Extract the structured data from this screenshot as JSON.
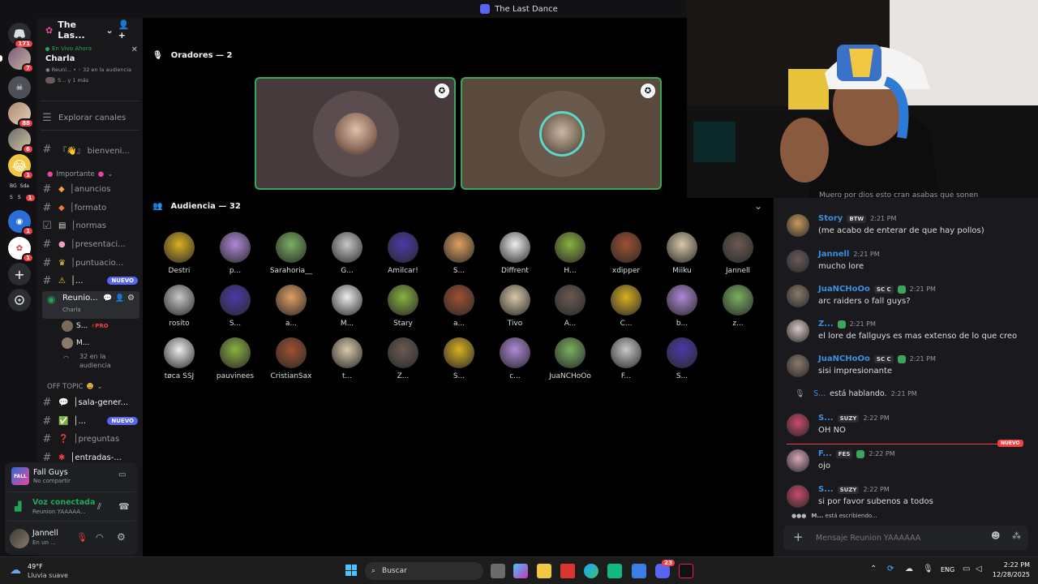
{
  "window": {
    "title": "The Last Dance"
  },
  "rail": {
    "badges": [
      "171",
      "7",
      "88",
      "6",
      "1",
      "1",
      "1",
      "1"
    ],
    "folder_labels": [
      "BG",
      "Sda",
      "S",
      "S"
    ]
  },
  "server": {
    "name": "The Las..."
  },
  "live_now": {
    "label": "En Vivo Ahora",
    "stage_name": "Charla",
    "meta_channel": "Reuni...",
    "meta_count": "32 en la audiencia",
    "speakers": "S... y 1 más"
  },
  "channels": {
    "explore": "Explorar canales",
    "bienvenida": "『👋』 bienveni...",
    "cat_importante": "Importante",
    "anuncios": "│anuncios",
    "formato": "│formato",
    "normas": "│normas",
    "presentacion": "│presentaci...",
    "puntuacion": "│puntuacio...",
    "alert": "│...",
    "alert_badge": "NUEVO",
    "stage_channel": "Reunio...",
    "stage_sub": "Charla",
    "speaker1": "S...",
    "speaker1_tag": "PRO",
    "speaker2": "M...",
    "audience_count": "32 en la",
    "audience_label": "audiencia",
    "cat_offtopic": "OFF TOPIC",
    "sala": "│sala-gener...",
    "check": "│...",
    "check_badge": "NUEVO",
    "preguntas": "│preguntas",
    "entradas": "│entradas-..."
  },
  "activity": {
    "game": "Fall Guys",
    "status": "No compartir"
  },
  "voice": {
    "status": "Voz conectada",
    "channel": "Reunion YAAAAA..."
  },
  "user": {
    "name": "Jannell",
    "status": "En un ..."
  },
  "stage": {
    "speakers_header": "Oradores — 2",
    "audience_header": "Audiencia — 32",
    "audience": [
      [
        "Destri",
        "p...",
        "Sarahoria__",
        "G...",
        "Amilcar!",
        "S...",
        "Diffrent",
        "H...",
        "xdipper",
        "Miiku",
        "Jannell"
      ],
      [
        "rosito",
        "S...",
        "a...",
        "M...",
        "Stary",
        "a...",
        "Tivo",
        "A...",
        "C...",
        "b...",
        "z..."
      ],
      [
        "tøca SSJ",
        "pauvinees",
        "CristianSax",
        "t...",
        "Z...",
        "S...",
        "c...",
        "JuaNCHoOo",
        "F...",
        "S..."
      ]
    ]
  },
  "chat": {
    "top_partial": "Muero por dios esto cran asabas que sonen",
    "messages": [
      {
        "name": "Story",
        "tag": "BTW",
        "time": "2:21 PM",
        "text": "(me acabo de enterar de que hay pollos)",
        "color": "#3b8ee0"
      },
      {
        "name": "Jannell",
        "tag": "",
        "time": "2:21 PM",
        "text": "mucho lore",
        "color": "#3b8ee0"
      },
      {
        "name": "JuaNCHoOo",
        "tag": "SC C",
        "time": "2:21 PM",
        "text": "arc raiders o fall guys?",
        "color": "#3b8ee0"
      },
      {
        "name": "Z...",
        "tag": "",
        "time": "2:21 PM",
        "text": "el lore de fallguys es mas extenso de lo que creo",
        "color": "#3b8ee0"
      },
      {
        "name": "JuaNCHoOo",
        "tag": "SC C",
        "time": "2:21 PM",
        "text": "sisi impresionante",
        "color": "#3b8ee0"
      },
      {
        "name": "S...",
        "tag": "SUZY",
        "time": "2:22 PM",
        "text": "OH NO",
        "color": "#3b8ee0"
      },
      {
        "name": "F...",
        "tag": "FES",
        "time": "2:22 PM",
        "text": "ojo",
        "color": "#3b8ee0"
      },
      {
        "name": "S...",
        "tag": "SUZY",
        "time": "2:22 PM",
        "text": "si por favor subenos a todos",
        "color": "#3b8ee0"
      }
    ],
    "speaking_user": "S...",
    "speaking_text": "está hablando.",
    "speaking_time": "2:21 PM",
    "new_divider": "NUEVO",
    "typing_user": "M...",
    "typing_text": "está escribiendo...",
    "input_placeholder": "Mensaje Reunion YAAAAAA"
  },
  "taskbar": {
    "weather_temp": "49°F",
    "weather_desc": "Lluvia suave",
    "search": "Buscar",
    "lang": "ENG",
    "time": "2:22 PM",
    "date": "12/28/2025",
    "discord_badge": "23"
  }
}
